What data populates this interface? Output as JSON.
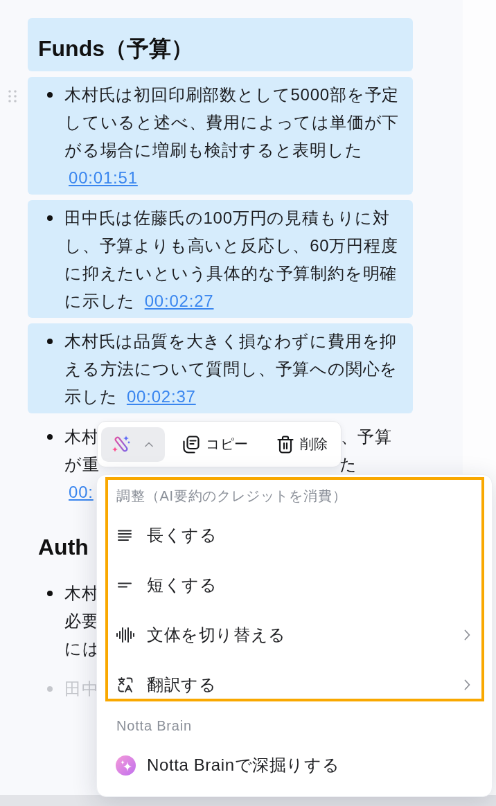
{
  "sections": [
    {
      "heading": {
        "text": "Funds（予算）",
        "selected": true
      },
      "items": [
        {
          "kind": "paragraph",
          "selected": true,
          "faded": false,
          "drag_handle": true,
          "text": "木村氏は初回印刷部数として5000部を予定していると述べ、費用によっては単価が下がる場合に増刷も検討すると表明した",
          "timestamp": "00:01:51"
        },
        {
          "kind": "paragraph",
          "selected": true,
          "faded": false,
          "drag_handle": false,
          "text": "田中氏は佐藤氏の100万円の見積もりに対し、予算よりも高いと反応し、60万円程度に抑えたいという具体的な予算制約を明確に示した",
          "timestamp": "00:02:27"
        },
        {
          "kind": "paragraph",
          "selected": true,
          "faded": false,
          "drag_handle": false,
          "text": "木村氏は品質を大きく損なわずに費用を抑える方法について質問し、予算への関心を示した",
          "timestamp": "00:02:37"
        },
        {
          "kind": "fragments",
          "selected": false,
          "faded": false,
          "drag_handle": false,
          "lines": [
            [
              "木村",
              "、予算"
            ],
            [
              "が重",
              "た"
            ]
          ],
          "timestamp": "00:"
        }
      ]
    },
    {
      "heading": {
        "text": "Auth",
        "selected": false
      },
      "items": [
        {
          "kind": "fragments",
          "selected": false,
          "faded": false,
          "drag_handle": false,
          "lines": [
            [
              "木村"
            ],
            [
              "必要"
            ],
            [
              "には"
            ]
          ]
        },
        {
          "kind": "fragments",
          "selected": false,
          "faded": true,
          "drag_handle": false,
          "lines": [
            [
              "田中"
            ]
          ]
        }
      ]
    }
  ],
  "toolbar": {
    "ai_button": {
      "expanded": true
    },
    "buttons": [
      {
        "kind": "copy",
        "label": "コピー"
      },
      {
        "kind": "delete",
        "label": "削除"
      }
    ]
  },
  "menu": {
    "sections": [
      {
        "title": "調整（AI要約のクレジットを消費）",
        "highlighted": true,
        "items": [
          {
            "kind": "lengthen",
            "label": "長くする",
            "submenu": false
          },
          {
            "kind": "shorten",
            "label": "短くする",
            "submenu": false
          },
          {
            "kind": "tone",
            "label": "文体を切り替える",
            "submenu": true
          },
          {
            "kind": "translate",
            "label": "翻訳する",
            "submenu": true
          }
        ]
      },
      {
        "title": "Notta Brain",
        "highlighted": false,
        "items": [
          {
            "kind": "brain",
            "label": "Notta Brainで深掘りする",
            "submenu": false
          }
        ]
      }
    ]
  }
}
